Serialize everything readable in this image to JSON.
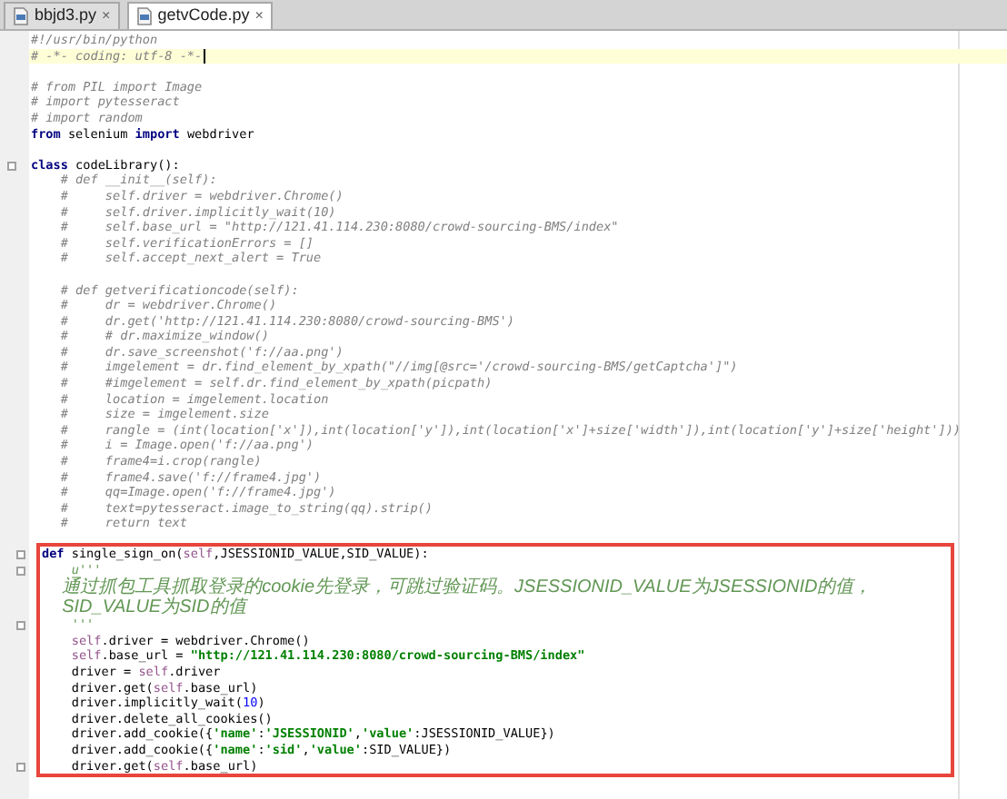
{
  "tabs": [
    {
      "label": "bbjd3.py",
      "close": "×",
      "selected": false
    },
    {
      "label": "getvCode.py",
      "close": "×",
      "selected": true
    }
  ],
  "editor": {
    "lines": [
      {
        "kind": "code",
        "current": false,
        "segs": [
          {
            "kind": "comment",
            "text": "#!/usr/bin/python"
          }
        ]
      },
      {
        "kind": "code",
        "current": true,
        "segs": [
          {
            "kind": "comment",
            "text": "# -*- coding: utf-8 -*-"
          }
        ]
      },
      {
        "kind": "blank"
      },
      {
        "kind": "code",
        "current": false,
        "segs": [
          {
            "kind": "comment",
            "text": "# from PIL import Image"
          }
        ]
      },
      {
        "kind": "code",
        "current": false,
        "segs": [
          {
            "kind": "comment",
            "text": "# import pytesseract"
          }
        ]
      },
      {
        "kind": "code",
        "current": false,
        "segs": [
          {
            "kind": "comment",
            "text": "# import random"
          }
        ]
      },
      {
        "kind": "code",
        "current": false,
        "segs": [
          {
            "kind": "keyword",
            "text": "from"
          },
          {
            "kind": "plain",
            "text": " selenium "
          },
          {
            "kind": "keyword",
            "text": "import"
          },
          {
            "kind": "plain",
            "text": " webdriver"
          }
        ]
      },
      {
        "kind": "blank"
      },
      {
        "kind": "code",
        "current": false,
        "fold": true,
        "segs": [
          {
            "kind": "keyword",
            "text": "class"
          },
          {
            "kind": "plain",
            "text": " codeLibrary():"
          }
        ]
      },
      {
        "kind": "code",
        "current": false,
        "segs": [
          {
            "kind": "comment",
            "text": "    # def __init__(self):"
          }
        ]
      },
      {
        "kind": "code",
        "current": false,
        "segs": [
          {
            "kind": "comment",
            "text": "    #     self.driver = webdriver.Chrome()"
          }
        ]
      },
      {
        "kind": "code",
        "current": false,
        "segs": [
          {
            "kind": "comment",
            "text": "    #     self.driver.implicitly_wait(10)"
          }
        ]
      },
      {
        "kind": "code",
        "current": false,
        "segs": [
          {
            "kind": "comment",
            "text": "    #     self.base_url = \"http://121.41.114.230:8080/crowd-sourcing-BMS/index\""
          }
        ]
      },
      {
        "kind": "code",
        "current": false,
        "segs": [
          {
            "kind": "comment",
            "text": "    #     self.verificationErrors = []"
          }
        ]
      },
      {
        "kind": "code",
        "current": false,
        "segs": [
          {
            "kind": "comment",
            "text": "    #     self.accept_next_alert = True"
          }
        ]
      },
      {
        "kind": "blank"
      },
      {
        "kind": "code",
        "current": false,
        "segs": [
          {
            "kind": "comment",
            "text": "    # def getverificationcode(self):"
          }
        ]
      },
      {
        "kind": "code",
        "current": false,
        "segs": [
          {
            "kind": "comment",
            "text": "    #     dr = webdriver.Chrome()"
          }
        ]
      },
      {
        "kind": "code",
        "current": false,
        "segs": [
          {
            "kind": "comment",
            "text": "    #     dr.get('http://121.41.114.230:8080/crowd-sourcing-BMS')"
          }
        ]
      },
      {
        "kind": "code",
        "current": false,
        "segs": [
          {
            "kind": "comment",
            "text": "    #     # dr.maximize_window()"
          }
        ]
      },
      {
        "kind": "code",
        "current": false,
        "segs": [
          {
            "kind": "comment",
            "text": "    #     dr.save_screenshot('f://aa.png')"
          }
        ]
      },
      {
        "kind": "code",
        "current": false,
        "segs": [
          {
            "kind": "comment",
            "text": "    #     imgelement = dr.find_element_by_xpath(\"//img[@src='/crowd-sourcing-BMS/getCaptcha']\")"
          }
        ]
      },
      {
        "kind": "code",
        "current": false,
        "segs": [
          {
            "kind": "comment",
            "text": "    #     #imgelement = self.dr.find_element_by_xpath(picpath)"
          }
        ]
      },
      {
        "kind": "code",
        "current": false,
        "segs": [
          {
            "kind": "comment",
            "text": "    #     location = imgelement.location"
          }
        ]
      },
      {
        "kind": "code",
        "current": false,
        "segs": [
          {
            "kind": "comment",
            "text": "    #     size = imgelement.size"
          }
        ]
      },
      {
        "kind": "code",
        "current": false,
        "segs": [
          {
            "kind": "comment",
            "text": "    #     rangle = (int(location['x']),int(location['y']),int(location['x']+size['width']),int(location['y']+size['height']))"
          }
        ]
      },
      {
        "kind": "code",
        "current": false,
        "segs": [
          {
            "kind": "comment",
            "text": "    #     i = Image.open('f://aa.png')"
          }
        ]
      },
      {
        "kind": "code",
        "current": false,
        "segs": [
          {
            "kind": "comment",
            "text": "    #     frame4=i.crop(rangle)"
          }
        ]
      },
      {
        "kind": "code",
        "current": false,
        "segs": [
          {
            "kind": "comment",
            "text": "    #     frame4.save('f://frame4.jpg')"
          }
        ]
      },
      {
        "kind": "code",
        "current": false,
        "segs": [
          {
            "kind": "comment",
            "text": "    #     qq=Image.open('f://frame4.jpg')"
          }
        ]
      },
      {
        "kind": "code",
        "current": false,
        "segs": [
          {
            "kind": "comment",
            "text": "    #     text=pytesseract.image_to_string(qq).strip()"
          }
        ]
      },
      {
        "kind": "code",
        "current": false,
        "segs": [
          {
            "kind": "comment",
            "text": "    #     return text"
          }
        ]
      }
    ],
    "highlighted_section": {
      "lines": [
        {
          "kind": "code",
          "current": false,
          "fold": true,
          "segs": [
            {
              "kind": "keyword",
              "text": "def"
            },
            {
              "kind": "plain",
              "text": " single_sign_on("
            },
            {
              "kind": "self",
              "text": "self"
            },
            {
              "kind": "plain",
              "text": ",JSESSIONID_VALUE,SID_VALUE):"
            }
          ]
        },
        {
          "kind": "code",
          "current": false,
          "fold": true,
          "segs": [
            {
              "kind": "docstring",
              "text": "    u'''"
            }
          ]
        },
        {
          "kind": "cjk",
          "current": false,
          "segs": [
            {
              "kind": "docstring",
              "text": "    通过抓包工具抓取登录的cookie先登录，可跳过验证码。JSESSIONID_VALUE为JSESSIONID的值，"
            }
          ]
        },
        {
          "kind": "cjk",
          "current": false,
          "segs": [
            {
              "kind": "docstring",
              "text": "    SID_VALUE为SID的值"
            }
          ]
        },
        {
          "kind": "code",
          "current": false,
          "fold": true,
          "segs": [
            {
              "kind": "docstring",
              "text": "    '''"
            }
          ]
        },
        {
          "kind": "code",
          "current": false,
          "segs": [
            {
              "kind": "self",
              "text": "    self"
            },
            {
              "kind": "plain",
              "text": ".driver = webdriver.Chrome()"
            }
          ]
        },
        {
          "kind": "code",
          "current": false,
          "segs": [
            {
              "kind": "self",
              "text": "    self"
            },
            {
              "kind": "plain",
              "text": ".base_url = "
            },
            {
              "kind": "string",
              "text": "\"http://121.41.114.230:8080/crowd-sourcing-BMS/index\""
            }
          ]
        },
        {
          "kind": "code",
          "current": false,
          "segs": [
            {
              "kind": "plain",
              "text": "    driver = "
            },
            {
              "kind": "self",
              "text": "self"
            },
            {
              "kind": "plain",
              "text": ".driver"
            }
          ]
        },
        {
          "kind": "code",
          "current": false,
          "segs": [
            {
              "kind": "plain",
              "text": "    driver.get("
            },
            {
              "kind": "self",
              "text": "self"
            },
            {
              "kind": "plain",
              "text": ".base_url)"
            }
          ]
        },
        {
          "kind": "code",
          "current": false,
          "segs": [
            {
              "kind": "plain",
              "text": "    driver.implicitly_wait("
            },
            {
              "kind": "number",
              "text": "10"
            },
            {
              "kind": "plain",
              "text": ")"
            }
          ]
        },
        {
          "kind": "code",
          "current": false,
          "segs": [
            {
              "kind": "plain",
              "text": "    driver.delete_all_cookies()"
            }
          ]
        },
        {
          "kind": "code",
          "current": false,
          "segs": [
            {
              "kind": "plain",
              "text": "    driver.add_cookie({"
            },
            {
              "kind": "string",
              "text": "'name'"
            },
            {
              "kind": "plain",
              "text": ":"
            },
            {
              "kind": "string",
              "text": "'JSESSIONID'"
            },
            {
              "kind": "plain",
              "text": ","
            },
            {
              "kind": "string",
              "text": "'value'"
            },
            {
              "kind": "plain",
              "text": ":JSESSIONID_VALUE})"
            }
          ]
        },
        {
          "kind": "code",
          "current": false,
          "segs": [
            {
              "kind": "plain",
              "text": "    driver.add_cookie({"
            },
            {
              "kind": "string",
              "text": "'name'"
            },
            {
              "kind": "plain",
              "text": ":"
            },
            {
              "kind": "string",
              "text": "'sid'"
            },
            {
              "kind": "plain",
              "text": ","
            },
            {
              "kind": "string",
              "text": "'value'"
            },
            {
              "kind": "plain",
              "text": ":SID_VALUE})"
            }
          ]
        },
        {
          "kind": "code",
          "current": false,
          "fold": true,
          "segs": [
            {
              "kind": "plain",
              "text": "    driver.get("
            },
            {
              "kind": "self",
              "text": "self"
            },
            {
              "kind": "plain",
              "text": ".base_url)"
            }
          ]
        }
      ]
    }
  }
}
